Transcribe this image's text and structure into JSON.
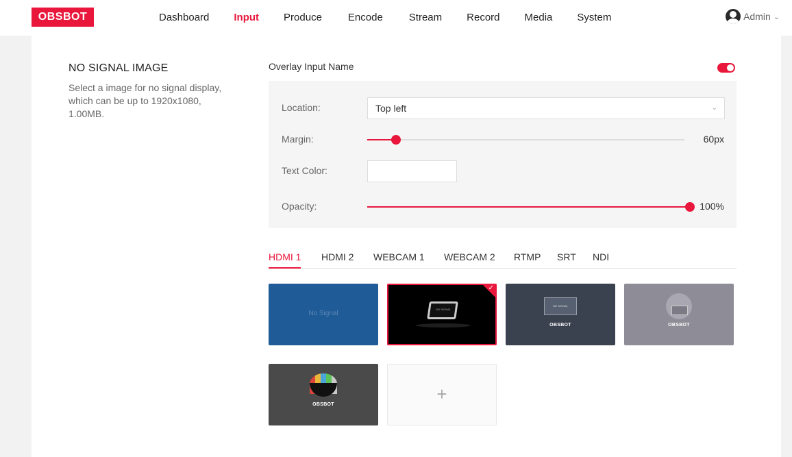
{
  "header": {
    "logo": "OBSBOT",
    "nav": [
      "Dashboard",
      "Input",
      "Produce",
      "Encode",
      "Stream",
      "Record",
      "Media",
      "System"
    ],
    "active_nav": "Input",
    "user": "Admin"
  },
  "no_signal": {
    "title": "NO SIGNAL IMAGE",
    "description": "Select a image for no signal display, which can be up to 1920x1080, 1.00MB."
  },
  "overlay": {
    "label": "Overlay Input Name",
    "enabled": true,
    "location_label": "Location:",
    "location_value": "Top left",
    "margin_label": "Margin:",
    "margin_value": "60px",
    "margin_fraction": 0.09,
    "text_color_label": "Text Color:",
    "text_color_value": "#ffffff",
    "opacity_label": "Opacity:",
    "opacity_value": "100%",
    "opacity_fraction": 1.0,
    "accent_color": "#e8173b"
  },
  "tabs": [
    "HDMI 1",
    "HDMI 2",
    "WEBCAM 1",
    "WEBCAM 2",
    "RTMP",
    "SRT",
    "NDI"
  ],
  "active_tab": "HDMI 1",
  "images": {
    "img1_text": "No Signal",
    "img2_text": "NO SIGNAL",
    "img3_text": "NO SIGNAL",
    "img3_brand": "OBSBOT",
    "img4_brand": "OBSBOT",
    "img5_brand": "OBSBOT",
    "add_label": "+"
  }
}
